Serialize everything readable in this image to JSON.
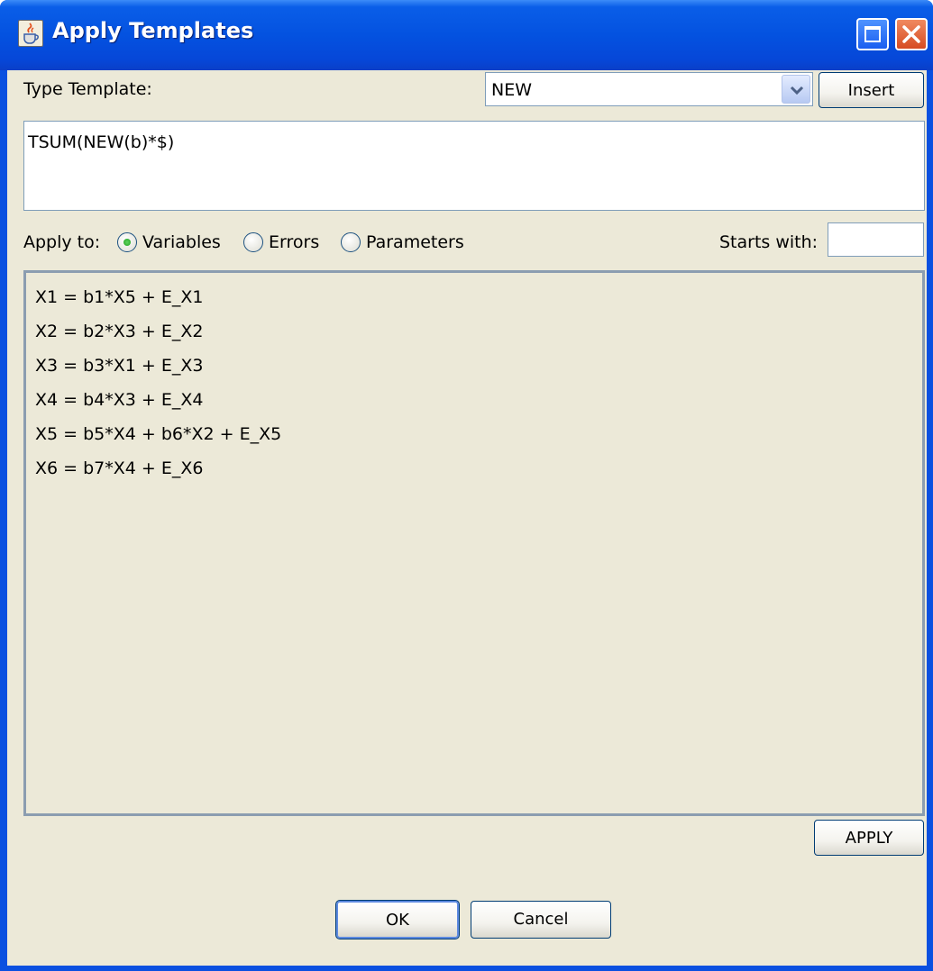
{
  "window": {
    "title": "Apply Templates"
  },
  "template": {
    "label": "Type Template:",
    "selected": "NEW",
    "insert_label": "Insert",
    "text": "TSUM(NEW(b)*$)"
  },
  "apply_to": {
    "label": "Apply to:",
    "options": [
      {
        "label": "Variables",
        "checked": true
      },
      {
        "label": "Errors",
        "checked": false
      },
      {
        "label": "Parameters",
        "checked": false
      }
    ],
    "starts_with_label": "Starts with:",
    "starts_with_value": ""
  },
  "equations": [
    "X1 = b1*X5 + E_X1",
    "X2 = b2*X3 + E_X2",
    "X3 = b3*X1 + E_X3",
    "X4 = b4*X3 + E_X4",
    "X5 = b5*X4 + b6*X2 + E_X5",
    "X6 = b7*X4 + E_X6"
  ],
  "buttons": {
    "apply": "APPLY",
    "ok": "OK",
    "cancel": "Cancel"
  },
  "icons": {
    "app": "java-cup-icon",
    "maximize": "maximize-icon",
    "close": "close-icon",
    "dropdown": "chevron-down-icon"
  }
}
